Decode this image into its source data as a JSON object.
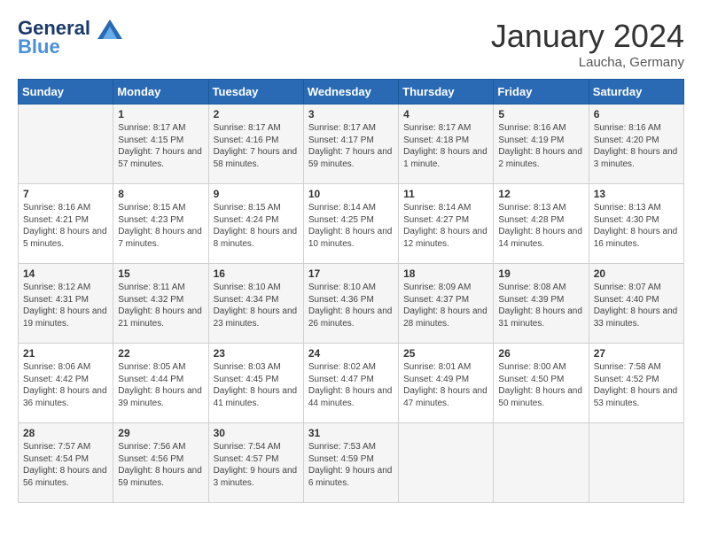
{
  "header": {
    "logo_line1": "General",
    "logo_line2": "Blue",
    "month_year": "January 2024",
    "location": "Laucha, Germany"
  },
  "days_of_week": [
    "Sunday",
    "Monday",
    "Tuesday",
    "Wednesday",
    "Thursday",
    "Friday",
    "Saturday"
  ],
  "weeks": [
    [
      {
        "day": "",
        "content": ""
      },
      {
        "day": "1",
        "content": "Sunrise: 8:17 AM\nSunset: 4:15 PM\nDaylight: 7 hours\nand 57 minutes."
      },
      {
        "day": "2",
        "content": "Sunrise: 8:17 AM\nSunset: 4:16 PM\nDaylight: 7 hours\nand 58 minutes."
      },
      {
        "day": "3",
        "content": "Sunrise: 8:17 AM\nSunset: 4:17 PM\nDaylight: 7 hours\nand 59 minutes."
      },
      {
        "day": "4",
        "content": "Sunrise: 8:17 AM\nSunset: 4:18 PM\nDaylight: 8 hours\nand 1 minute."
      },
      {
        "day": "5",
        "content": "Sunrise: 8:16 AM\nSunset: 4:19 PM\nDaylight: 8 hours\nand 2 minutes."
      },
      {
        "day": "6",
        "content": "Sunrise: 8:16 AM\nSunset: 4:20 PM\nDaylight: 8 hours\nand 3 minutes."
      }
    ],
    [
      {
        "day": "7",
        "content": "Sunrise: 8:16 AM\nSunset: 4:21 PM\nDaylight: 8 hours\nand 5 minutes."
      },
      {
        "day": "8",
        "content": "Sunrise: 8:15 AM\nSunset: 4:23 PM\nDaylight: 8 hours\nand 7 minutes."
      },
      {
        "day": "9",
        "content": "Sunrise: 8:15 AM\nSunset: 4:24 PM\nDaylight: 8 hours\nand 8 minutes."
      },
      {
        "day": "10",
        "content": "Sunrise: 8:14 AM\nSunset: 4:25 PM\nDaylight: 8 hours\nand 10 minutes."
      },
      {
        "day": "11",
        "content": "Sunrise: 8:14 AM\nSunset: 4:27 PM\nDaylight: 8 hours\nand 12 minutes."
      },
      {
        "day": "12",
        "content": "Sunrise: 8:13 AM\nSunset: 4:28 PM\nDaylight: 8 hours\nand 14 minutes."
      },
      {
        "day": "13",
        "content": "Sunrise: 8:13 AM\nSunset: 4:30 PM\nDaylight: 8 hours\nand 16 minutes."
      }
    ],
    [
      {
        "day": "14",
        "content": "Sunrise: 8:12 AM\nSunset: 4:31 PM\nDaylight: 8 hours\nand 19 minutes."
      },
      {
        "day": "15",
        "content": "Sunrise: 8:11 AM\nSunset: 4:32 PM\nDaylight: 8 hours\nand 21 minutes."
      },
      {
        "day": "16",
        "content": "Sunrise: 8:10 AM\nSunset: 4:34 PM\nDaylight: 8 hours\nand 23 minutes."
      },
      {
        "day": "17",
        "content": "Sunrise: 8:10 AM\nSunset: 4:36 PM\nDaylight: 8 hours\nand 26 minutes."
      },
      {
        "day": "18",
        "content": "Sunrise: 8:09 AM\nSunset: 4:37 PM\nDaylight: 8 hours\nand 28 minutes."
      },
      {
        "day": "19",
        "content": "Sunrise: 8:08 AM\nSunset: 4:39 PM\nDaylight: 8 hours\nand 31 minutes."
      },
      {
        "day": "20",
        "content": "Sunrise: 8:07 AM\nSunset: 4:40 PM\nDaylight: 8 hours\nand 33 minutes."
      }
    ],
    [
      {
        "day": "21",
        "content": "Sunrise: 8:06 AM\nSunset: 4:42 PM\nDaylight: 8 hours\nand 36 minutes."
      },
      {
        "day": "22",
        "content": "Sunrise: 8:05 AM\nSunset: 4:44 PM\nDaylight: 8 hours\nand 39 minutes."
      },
      {
        "day": "23",
        "content": "Sunrise: 8:03 AM\nSunset: 4:45 PM\nDaylight: 8 hours\nand 41 minutes."
      },
      {
        "day": "24",
        "content": "Sunrise: 8:02 AM\nSunset: 4:47 PM\nDaylight: 8 hours\nand 44 minutes."
      },
      {
        "day": "25",
        "content": "Sunrise: 8:01 AM\nSunset: 4:49 PM\nDaylight: 8 hours\nand 47 minutes."
      },
      {
        "day": "26",
        "content": "Sunrise: 8:00 AM\nSunset: 4:50 PM\nDaylight: 8 hours\nand 50 minutes."
      },
      {
        "day": "27",
        "content": "Sunrise: 7:58 AM\nSunset: 4:52 PM\nDaylight: 8 hours\nand 53 minutes."
      }
    ],
    [
      {
        "day": "28",
        "content": "Sunrise: 7:57 AM\nSunset: 4:54 PM\nDaylight: 8 hours\nand 56 minutes."
      },
      {
        "day": "29",
        "content": "Sunrise: 7:56 AM\nSunset: 4:56 PM\nDaylight: 8 hours\nand 59 minutes."
      },
      {
        "day": "30",
        "content": "Sunrise: 7:54 AM\nSunset: 4:57 PM\nDaylight: 9 hours\nand 3 minutes."
      },
      {
        "day": "31",
        "content": "Sunrise: 7:53 AM\nSunset: 4:59 PM\nDaylight: 9 hours\nand 6 minutes."
      },
      {
        "day": "",
        "content": ""
      },
      {
        "day": "",
        "content": ""
      },
      {
        "day": "",
        "content": ""
      }
    ]
  ]
}
